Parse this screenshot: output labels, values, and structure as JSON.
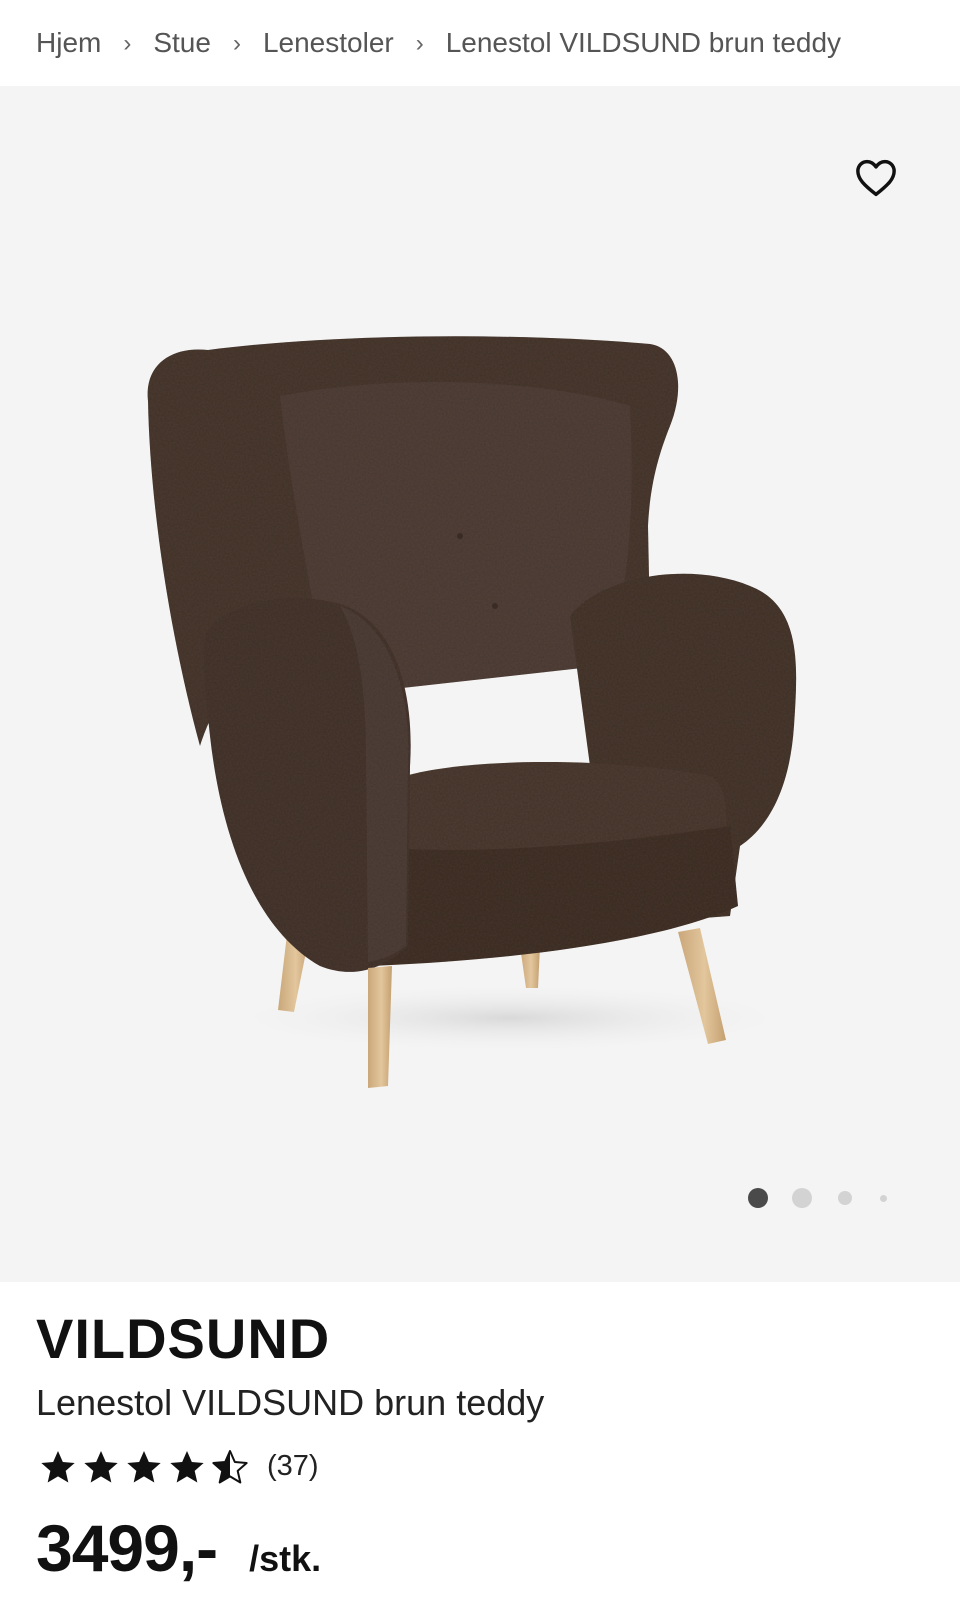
{
  "breadcrumb": {
    "items": [
      "Hjem",
      "Stue",
      "Lenestoler",
      "Lenestol VILDSUND brun teddy"
    ],
    "separator": "›"
  },
  "gallery": {
    "favorite_icon": "heart-outline-icon",
    "image_alt": "Lenestol VILDSUND brun teddy",
    "active_slide": 1,
    "slide_count": 4,
    "background_color": "#f4f4f4"
  },
  "product": {
    "brand": "VILDSUND",
    "name": "Lenestol VILDSUND brun teddy",
    "rating": 4.5,
    "rating_max": 5,
    "review_count": "(37)",
    "price": "3499,-",
    "unit": "/stk."
  },
  "colors": {
    "fabric": "#4a3a31",
    "legs": "#d7b88f",
    "dot_active": "#4a4a4a",
    "dot_inactive": "#d3d3d3"
  }
}
